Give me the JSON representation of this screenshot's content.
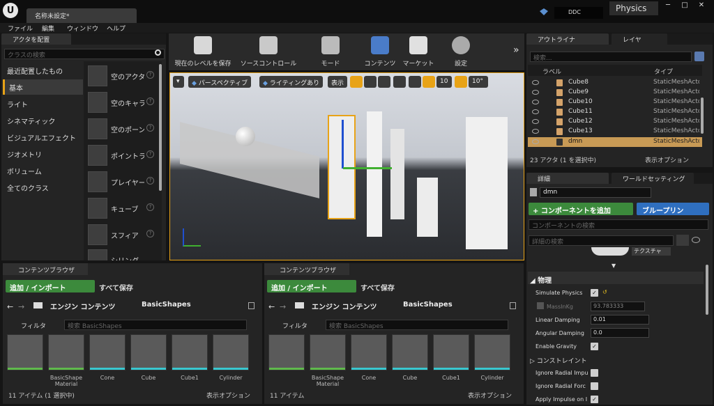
{
  "window": {
    "doc_tab": "名称未設定*",
    "ddc": "DDC",
    "physics_tab": "Physics"
  },
  "menu": [
    "ファイル",
    "編集",
    "ウィンドウ",
    "ヘルプ"
  ],
  "place": {
    "tab": "アクタを配置",
    "search_placeholder": "クラスの検索",
    "categories": [
      "最近配置したもの",
      "基本",
      "ライト",
      "シネマティック",
      "ビジュアルエフェクト",
      "ジオメトリ",
      "ボリューム",
      "全てのクラス"
    ],
    "actors": [
      "空のアクタ",
      "空のキャラ",
      "空のポーン",
      "ポイントラ",
      "プレイヤー",
      "キューブ",
      "スフィア",
      "シリンダ"
    ]
  },
  "toolbar": [
    "現在のレベルを保存",
    "ソースコントロール",
    "モード",
    "コンテンツ",
    "マーケット",
    "設定"
  ],
  "viewport": {
    "perspective": "パースペクティブ",
    "lighting": "ライティングあり",
    "show": "表示",
    "grid_snap": "10",
    "rot_snap": "10°"
  },
  "outliner": {
    "tab": "アウトライナ",
    "layers_tab": "レイヤ",
    "search_placeholder": "検索...",
    "col_label": "ラベル",
    "col_type": "タイプ",
    "rows": [
      {
        "name": "Cube8",
        "type": "StaticMeshActor"
      },
      {
        "name": "Cube9",
        "type": "StaticMeshActor"
      },
      {
        "name": "Cube10",
        "type": "StaticMeshActor"
      },
      {
        "name": "Cube11",
        "type": "StaticMeshActor"
      },
      {
        "name": "Cube12",
        "type": "StaticMeshActor"
      },
      {
        "name": "Cube13",
        "type": "StaticMeshActor"
      },
      {
        "name": "dmn",
        "type": "StaticMeshActor"
      }
    ],
    "status": "23 アクタ (1 を選択中)",
    "view_options": "表示オプション"
  },
  "details": {
    "tab": "詳細",
    "world_tab": "ワールドセッティング",
    "name": "dmn",
    "add_component": "+ コンポーネントを追加",
    "blueprint": "ブループリン",
    "comp_search": "コンポーネントの検索",
    "detail_search": "詳細の検索",
    "texture_btn": "テクスチャ",
    "section": "物理",
    "props": [
      {
        "label": "Simulate Physics",
        "type": "check",
        "value": "✓"
      },
      {
        "label": "MassInKg",
        "type": "num",
        "value": "93.783333"
      },
      {
        "label": "Linear Damping",
        "type": "num",
        "value": "0.01"
      },
      {
        "label": "Angular Damping",
        "type": "num",
        "value": "0.0"
      },
      {
        "label": "Enable Gravity",
        "type": "check",
        "value": "✓"
      },
      {
        "label": "コンストレイント",
        "type": "group",
        "value": ""
      },
      {
        "label": "Ignore Radial Impu",
        "type": "check",
        "value": ""
      },
      {
        "label": "Ignore Radial Forc",
        "type": "check",
        "value": ""
      },
      {
        "label": "Apply Impulse on I",
        "type": "check",
        "value": "✓"
      }
    ]
  },
  "cb1": {
    "tab": "コンテンツブラウザ",
    "add": "追加 / インポート",
    "save_all": "すべて保存",
    "crumb1": "エンジン コンテンツ",
    "crumb2": "BasicShapes",
    "filter": "フィルタ",
    "search_placeholder": "検索 BasicShapes",
    "status": "11 アイテム (1 選択中)",
    "view_options": "表示オプション",
    "assets": [
      "",
      "BasicShape Material",
      "Cone",
      "Cube",
      "Cube1",
      "Cylinder"
    ]
  },
  "cb2": {
    "tab": "コンテンツブラウザ",
    "add": "追加 / インポート",
    "save_all": "すべて保存",
    "crumb1": "エンジン コンテンツ",
    "crumb2": "BasicShapes",
    "filter": "フィルタ",
    "search_placeholder": "検索 BasicShapes",
    "status": "11 アイテム",
    "view_options": "表示オプション",
    "assets": [
      "",
      "BasicShape Material",
      "Cone",
      "Cube",
      "Cube1",
      "Cylinder"
    ]
  }
}
